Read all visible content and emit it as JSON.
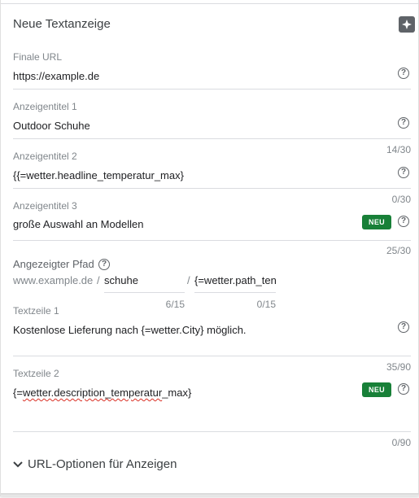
{
  "title": "Neue Textanzeige",
  "fields": {
    "final_url": {
      "label": "Finale URL",
      "value": "https://example.de"
    },
    "headline1": {
      "label": "Anzeigentitel 1",
      "value": "Outdoor Schuhe",
      "counter": "14/30"
    },
    "headline2": {
      "label": "Anzeigentitel 2",
      "value": "{{=wetter.headline_temperatur_max}",
      "counter": "0/30"
    },
    "headline3": {
      "label": "Anzeigentitel 3",
      "value": "große Auswahl an Modellen",
      "badge": "NEU",
      "counter": "25/30"
    },
    "display_path": {
      "label": "Angezeigter Pfad",
      "domain": "www.example.de",
      "separator1": "/",
      "path1": "schuhe",
      "separator2": "/",
      "path2": "{=wetter.path_ten",
      "path1_counter": "6/15",
      "path2_counter": "0/15"
    },
    "text1": {
      "label": "Textzeile 1",
      "value": "Kostenlose Lieferung nach {=wetter.City} möglich.",
      "counter": "35/90"
    },
    "text2": {
      "label": "Textzeile 2",
      "value_prefix": "{=",
      "value_misspelled": "wetter.description_temperatur",
      "value_suffix": "_max}",
      "badge": "NEU",
      "counter": "0/90"
    }
  },
  "help_glyph": "?",
  "url_options_label": "URL-Optionen für Anzeigen",
  "icons": {
    "help": "help-circle-icon",
    "spark": "sparkle-icon",
    "chevron": "chevron-down-icon"
  },
  "colors": {
    "badge": "#188038",
    "divider": "#dadce0",
    "label": "#80868b"
  }
}
